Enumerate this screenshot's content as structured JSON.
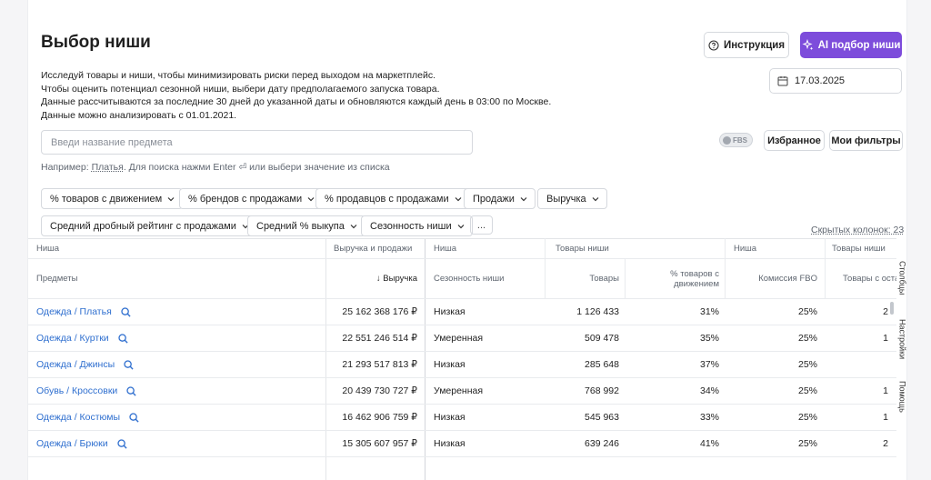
{
  "page": {
    "title": "Выбор ниши",
    "instruction_label": "Инструкция",
    "ai_label": "AI подбор ниши",
    "description": [
      "Исследуй товары и ниши, чтобы минимизировать риски перед выходом на маркетплейс.",
      "Чтобы оценить потенциал сезонной ниши, выбери дату предполагаемого запуска товара.",
      "Данные рассчитываются за последние 30 дней до указанной даты и обновляются каждый день в 03:00 по Москве.",
      "Данные можно анализировать с 01.01.2021."
    ],
    "date": "17.03.2025"
  },
  "search": {
    "placeholder": "Введи название предмета",
    "hint_prefix": "Например:",
    "hint_example": "Платья",
    "hint_suffix": "Для поиска нажми Enter ⏎ или выбери значение из списка"
  },
  "toolbar": {
    "fbs_label": "FBS",
    "favorites_label": "Избранное",
    "my_filters_label": "Мои фильтры"
  },
  "filters": [
    "% товаров с движением",
    "% брендов с продажами",
    "% продавцов с продажами",
    "Продажи",
    "Выручка",
    "Средний дробный рейтинг с продажами",
    "Средний % выкупа",
    "Сезонность ниши"
  ],
  "more_label": "...",
  "hidden_columns": "Скрытых колонок: 23",
  "table": {
    "group_headers": [
      "Ниша",
      "Выручка и продажи",
      "Ниша",
      "Товары ниши",
      "Ниша",
      "Товары ниши"
    ],
    "headers": [
      "Предметы",
      "↓ Выручка",
      "Сезонность ниши",
      "Товары",
      "% товаров с движением",
      "Комиссия FBO",
      "Товары с остат"
    ],
    "rows": [
      {
        "niche": "Одежда / Платья",
        "revenue": "25 162 368 176 ₽",
        "season": "Низкая",
        "goods": "1 126 433",
        "moving": "31%",
        "fbo": "25%",
        "stock": "2"
      },
      {
        "niche": "Одежда / Куртки",
        "revenue": "22 551 246 514 ₽",
        "season": "Умеренная",
        "goods": "509 478",
        "moving": "35%",
        "fbo": "25%",
        "stock": "1"
      },
      {
        "niche": "Одежда / Джинсы",
        "revenue": "21 293 517 813 ₽",
        "season": "Низкая",
        "goods": "285 648",
        "moving": "37%",
        "fbo": "25%",
        "stock": ""
      },
      {
        "niche": "Обувь / Кроссовки",
        "revenue": "20 439 730 727 ₽",
        "season": "Умеренная",
        "goods": "768 992",
        "moving": "34%",
        "fbo": "25%",
        "stock": "1"
      },
      {
        "niche": "Одежда / Костюмы",
        "revenue": "16 462 906 759 ₽",
        "season": "Низкая",
        "goods": "545 963",
        "moving": "33%",
        "fbo": "25%",
        "stock": "1"
      },
      {
        "niche": "Одежда / Брюки",
        "revenue": "15 305 607 957 ₽",
        "season": "Низкая",
        "goods": "639 246",
        "moving": "41%",
        "fbo": "25%",
        "stock": "2"
      }
    ]
  },
  "side_tabs": [
    "Столбцы",
    "Настройки",
    "Помощь"
  ],
  "colors": {
    "accent": "#7d4cdb",
    "link": "#2f6fcf"
  }
}
